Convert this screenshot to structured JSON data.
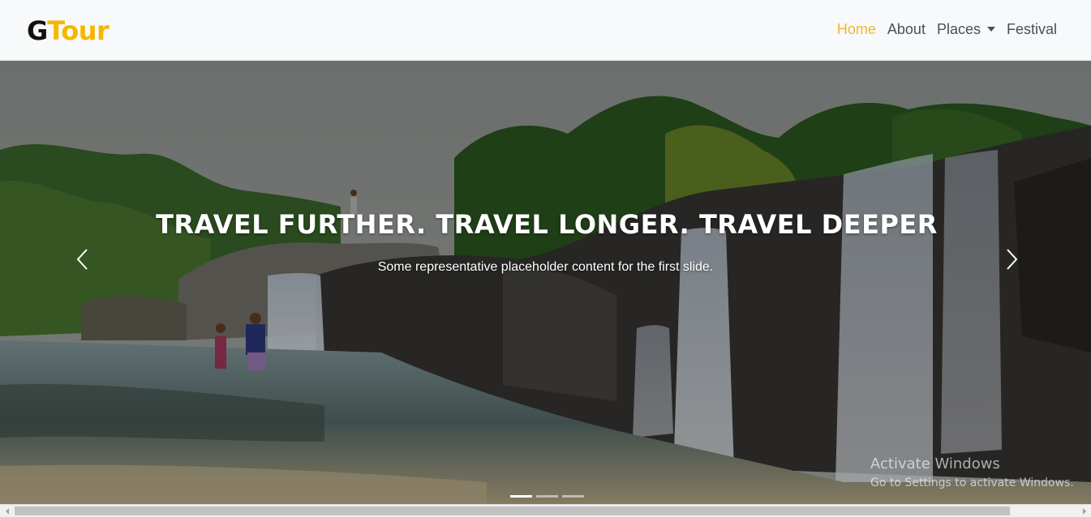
{
  "navbar": {
    "brand_first": "G",
    "brand_rest": "Tour",
    "links": [
      "Home",
      "About",
      "Places",
      "Festival"
    ],
    "active_link": "Home",
    "colors": {
      "brand_accent": "#f5b700",
      "active_link": "#f2b632",
      "background": "#f8f9fa"
    }
  },
  "carousel": {
    "slides_count": 3,
    "active_slide": 1,
    "caption": {
      "title": "TRAVEL FURTHER. TRAVEL LONGER. TRAVEL DEEPER",
      "text": "Some representative placeholder content for the first slide."
    },
    "prev_icon": "chevron-left-icon",
    "next_icon": "chevron-right-icon"
  },
  "watermark": {
    "line1": "Activate Windows",
    "line2": "Go to Settings to activate Windows."
  }
}
